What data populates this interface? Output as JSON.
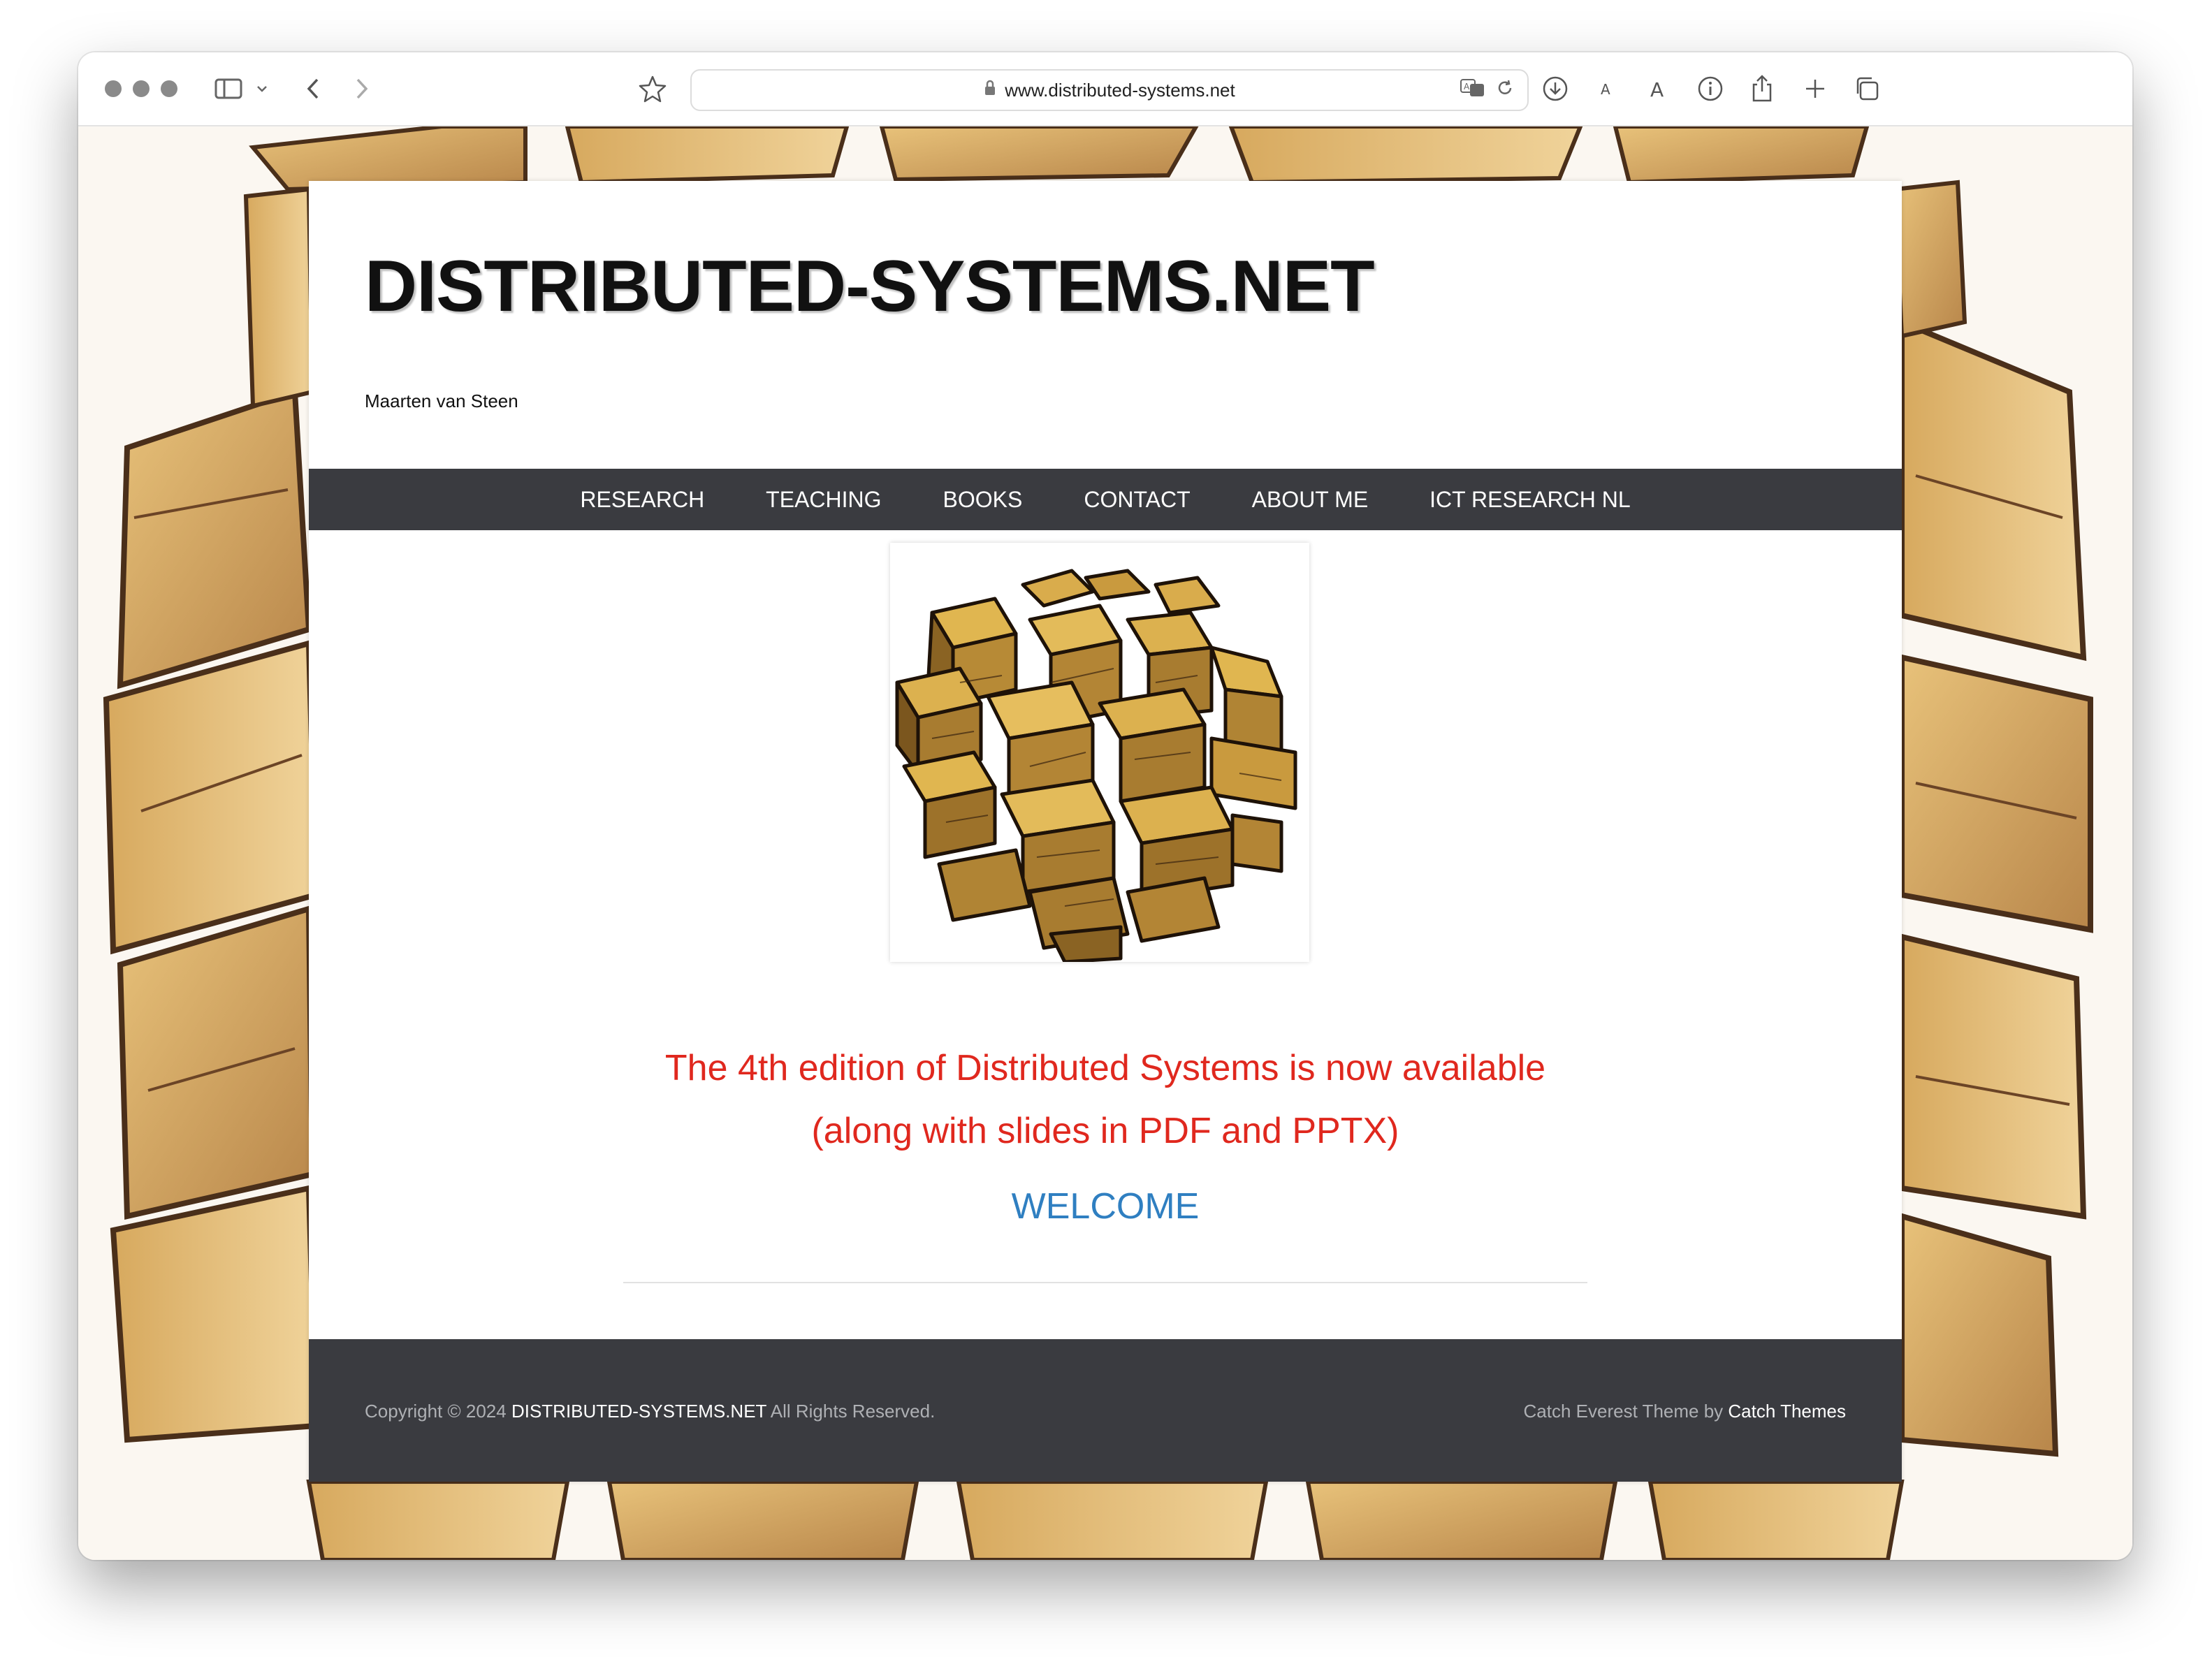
{
  "browser": {
    "url": "www.distributed-systems.net"
  },
  "site": {
    "title": "DISTRIBUTED-SYSTEMS.NET",
    "tagline": "Maarten van Steen"
  },
  "nav": {
    "items": [
      "RESEARCH",
      "TEACHING",
      "BOOKS",
      "CONTACT",
      "ABOUT ME",
      "ICT RESEARCH NL"
    ]
  },
  "main": {
    "notice_line1": "The 4th edition of Distributed Systems is now available",
    "notice_line2": "(along with slides in PDF and PPTX)",
    "welcome": "WELCOME"
  },
  "footer": {
    "copyright_prefix": "Copyright © 2024",
    "site_link": "DISTRIBUTED-SYSTEMS.NET",
    "rights": "All Rights Reserved.",
    "theme_prefix": "Catch Everest Theme by",
    "theme_link": "Catch Themes"
  },
  "colors": {
    "notice": "#e0281e",
    "welcome": "#2f7fc1",
    "nav_bg": "#3a3b40"
  }
}
